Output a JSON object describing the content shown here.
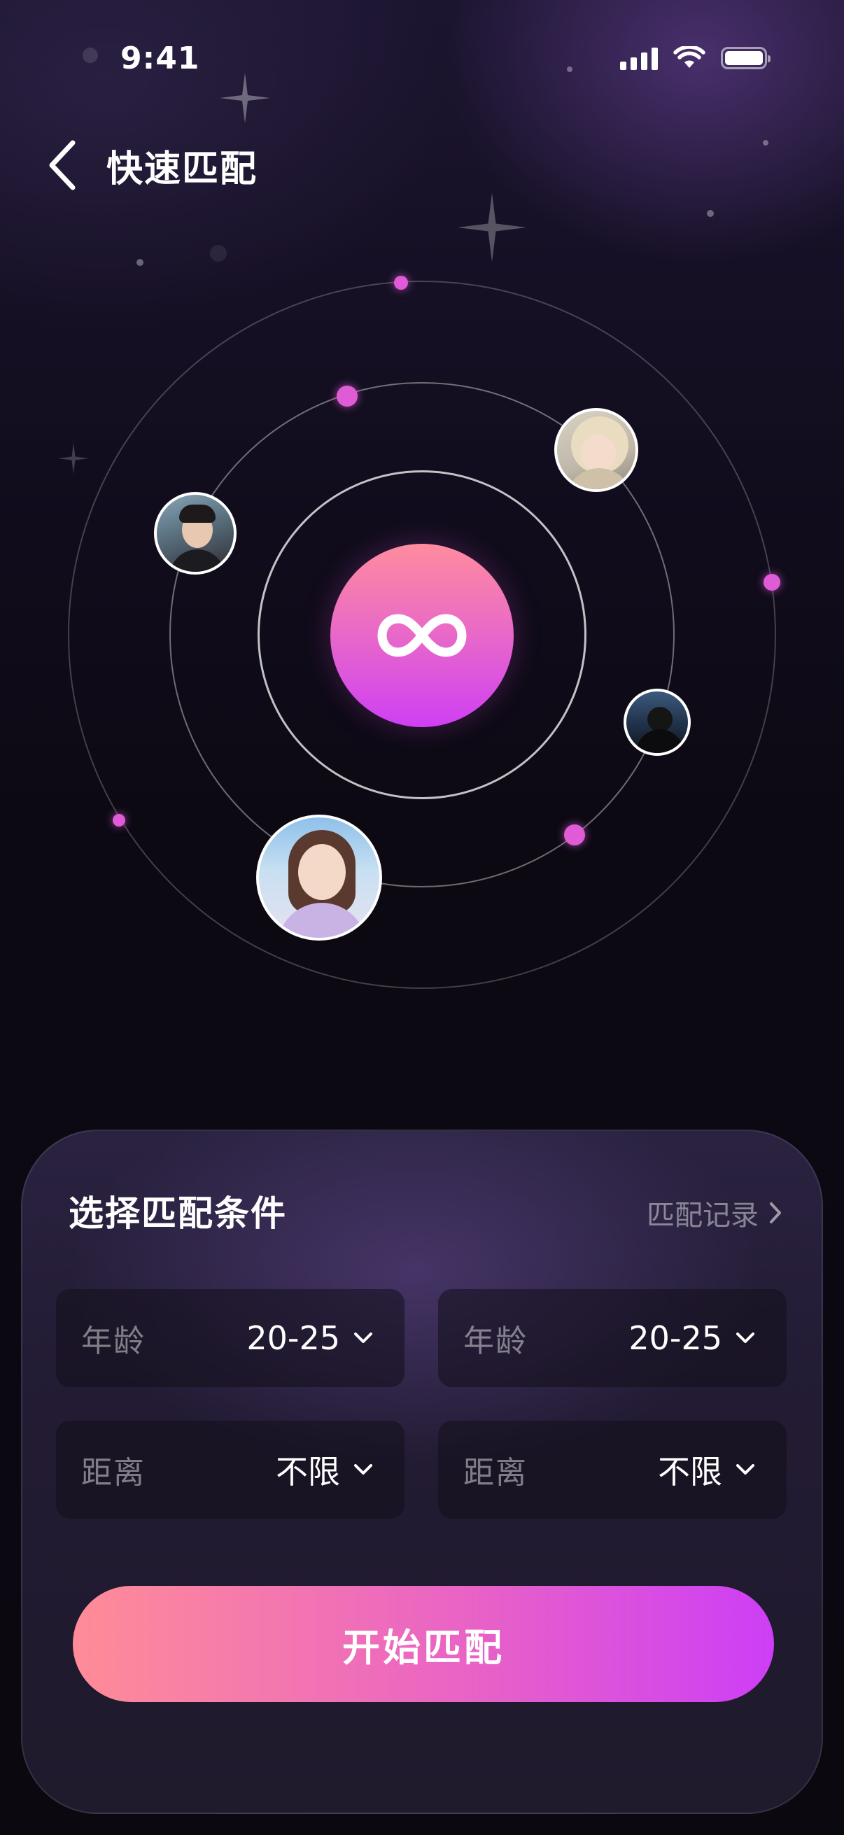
{
  "status_bar": {
    "time": "9:41",
    "icons": [
      "cellular-signal-icon",
      "wifi-icon",
      "battery-icon"
    ]
  },
  "header": {
    "back_icon": "chevron-left-icon",
    "title": "快速匹配"
  },
  "orbit": {
    "center_icon": "infinity-icon",
    "avatars": [
      {
        "name": "avatar-male-left",
        "desc": "profile photo"
      },
      {
        "name": "avatar-female-top-right",
        "desc": "profile photo"
      },
      {
        "name": "avatar-dark-right",
        "desc": "profile photo"
      },
      {
        "name": "avatar-female-bottom",
        "desc": "profile photo"
      }
    ],
    "accent_color": "#e05bd6"
  },
  "match_card": {
    "title": "选择匹配条件",
    "history_link": "匹配记录",
    "history_icon": "chevron-right-icon",
    "filters": [
      {
        "label": "年龄",
        "value": "20-25"
      },
      {
        "label": "年龄",
        "value": "20-25"
      },
      {
        "label": "距离",
        "value": "不限"
      },
      {
        "label": "距离",
        "value": "不限"
      }
    ],
    "start_button": "开始匹配"
  },
  "colors": {
    "gradient_start": "#ff8c97",
    "gradient_end": "#cd3ef6",
    "background": "#0d0914"
  }
}
